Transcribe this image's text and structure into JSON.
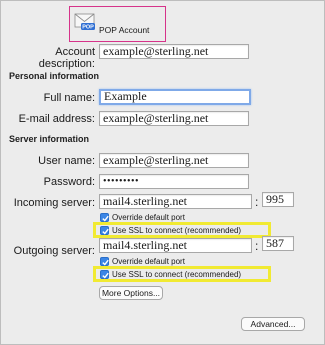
{
  "header": {
    "account_type": "POP Account"
  },
  "account_description": {
    "label": "Account description:",
    "value": "example@sterling.net"
  },
  "personal": {
    "heading": "Personal information",
    "full_name_label": "Full name:",
    "full_name": "Example",
    "email_label": "E-mail address:",
    "email": "example@sterling.net"
  },
  "server": {
    "heading": "Server information",
    "username_label": "User name:",
    "username": "example@sterling.net",
    "password_label": "Password:",
    "password": "•••••••••",
    "incoming_label": "Incoming server:",
    "incoming": "mail4.sterling.net",
    "incoming_port": "995",
    "incoming_override": "Override default port",
    "incoming_ssl": "Use SSL to connect (recommended)",
    "outgoing_label": "Outgoing server:",
    "outgoing": "mail4.sterling.net",
    "outgoing_port": "587",
    "outgoing_override": "Override default port",
    "outgoing_ssl": "Use SSL to connect (recommended)",
    "colon": ":",
    "more_options": "More Options..."
  },
  "footer": {
    "advanced": "Advanced..."
  },
  "colors": {
    "header_highlight": "#d6338a",
    "callout_highlight": "#f1ea32",
    "checkbox": "#3b86e6"
  },
  "icons": {
    "account": "envelope-pop-icon",
    "check": "checkmark-icon"
  }
}
